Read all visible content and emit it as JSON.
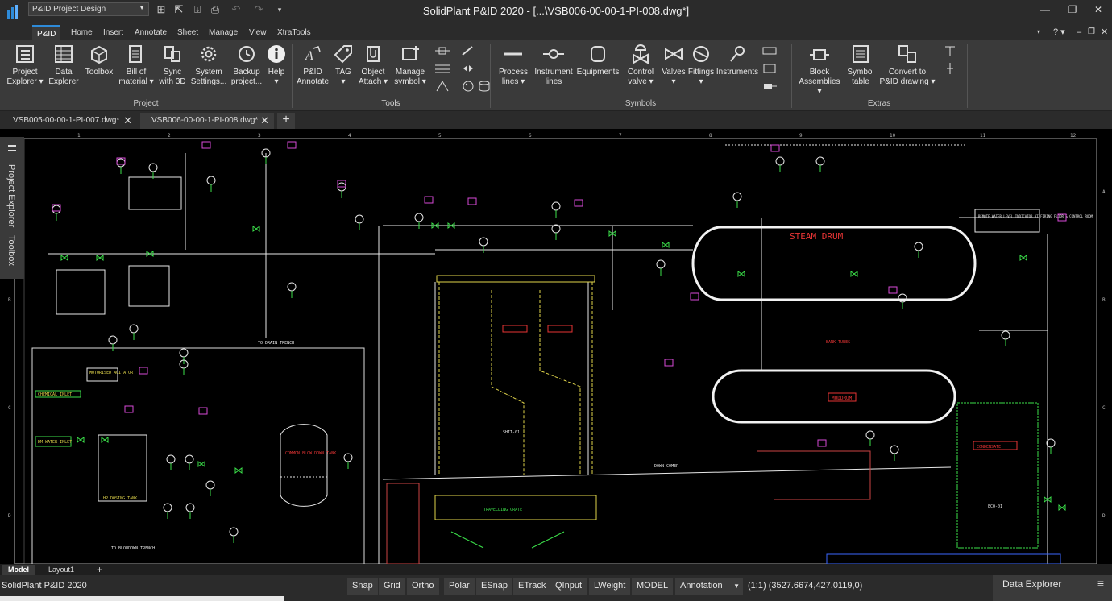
{
  "titlebar": {
    "workspace": "P&ID Project Design",
    "title": "SolidPlant P&ID 2020 - [...\\VSB006-00-00-1-PI-008.dwg*]"
  },
  "ribbon_tabs": [
    "P&ID",
    "Home",
    "Insert",
    "Annotate",
    "Sheet",
    "Manage",
    "View",
    "XtraTools"
  ],
  "ribbon": {
    "project": {
      "label": "Project",
      "buttons": [
        "Project\nExplorer ▾",
        "Data\nExplorer",
        "Toolbox",
        "Bill of\nmaterial ▾",
        "Sync\nwith 3D",
        "System\nSettings...",
        "Backup\nproject...",
        "Help\n▾"
      ]
    },
    "tools": {
      "label": "Tools",
      "buttons": [
        "P&ID\nAnnotate",
        "TAG\n▾",
        "Object\nAttach ▾",
        "Manage\nsymbol ▾"
      ]
    },
    "symbols": {
      "label": "Symbols",
      "buttons": [
        "Process\nlines ▾",
        "Instrument\nlines",
        "Equipments",
        "Control\nvalve ▾",
        "Valves\n▾",
        "Fittings\n▾",
        "Instruments"
      ]
    },
    "extras": {
      "label": "Extras",
      "buttons": [
        "Block\nAssemblies ▾",
        "Symbol\ntable",
        "Convert to\nP&ID drawing ▾"
      ]
    }
  },
  "doc_tabs": [
    {
      "label": "VSB005-00-00-1-PI-007.dwg*",
      "active": false
    },
    {
      "label": "VSB006-00-00-1-PI-008.dwg*",
      "active": true
    }
  ],
  "side_palette": [
    "Project Explorer",
    "Toolbox"
  ],
  "drawing": {
    "labels": {
      "steam_drum": "STEAM DRUM",
      "mud_drum": "MUDDRUM",
      "boiler": "SHIT-01",
      "condensate": "CONDENSATE",
      "chemical_inlet": "CHEMICAL INLET",
      "dm_water": "DM WATER INLET",
      "motorized_agitator": "MOTORISED AGITATOR",
      "dosing_tank": "HP DOSING TANK",
      "blowdown_tank": "COMMON BLOW DOWN TANK",
      "to_blowdown": "TO BLOWDOWN TRENCH",
      "to_drain": "TO DRAIN TRENCH",
      "travelling_grate": "TRAVELLING GRATE",
      "eco": "ECO-01",
      "remote_water": "REMOTE WATER LEVEL INDICATOR AT FIRING FLOOR & CONTROL ROOM",
      "bank_tubes": "BANK TUBES",
      "down_comer": "DOWN COMER"
    },
    "col_numbers": [
      "1",
      "2",
      "3",
      "4",
      "5",
      "6",
      "7",
      "8",
      "9",
      "10",
      "11",
      "12"
    ],
    "row_letters": [
      "A",
      "B",
      "C",
      "D"
    ]
  },
  "layout_tabs": [
    "Model",
    "Layout1"
  ],
  "statusbar": {
    "app": "SolidPlant P&ID 2020",
    "toggles": [
      "Snap",
      "Grid",
      "Ortho",
      "Polar",
      "ESnap",
      "ETrack",
      "QInput",
      "LWeight",
      "MODEL"
    ],
    "annotation": "Annotation",
    "scale": "(1:1)",
    "coords": "(3527.6674,427.0119,0)",
    "data_explorer": "Data Explorer"
  }
}
